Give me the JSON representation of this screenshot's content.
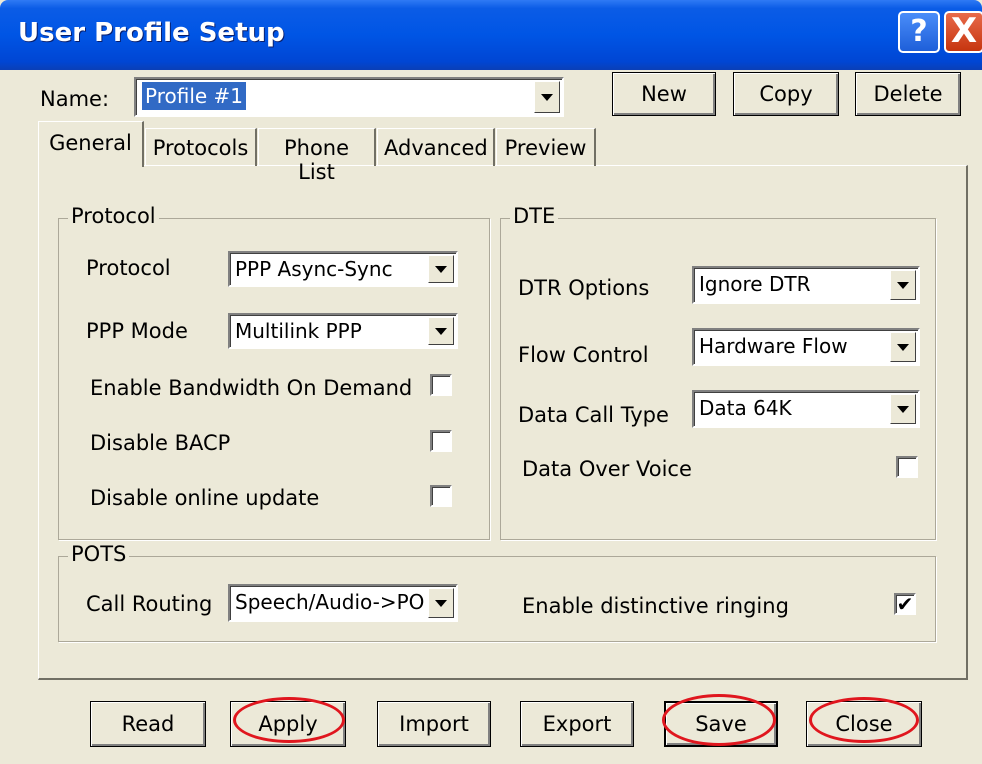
{
  "window": {
    "title": "User Profile Setup",
    "help_icon": "?",
    "close_icon": "X"
  },
  "name_row": {
    "label": "Name:",
    "value": "Profile #1",
    "new": "New",
    "copy": "Copy",
    "delete": "Delete"
  },
  "tabs": [
    "General",
    "Protocols",
    "Phone List",
    "Advanced",
    "Preview"
  ],
  "protocol_group": {
    "title": "Protocol",
    "protocol_label": "Protocol",
    "protocol_value": "PPP Async-Sync",
    "ppp_mode_label": "PPP Mode",
    "ppp_mode_value": "Multilink PPP",
    "bandwidth_label": "Enable Bandwidth On Demand",
    "bandwidth_checked": false,
    "bacp_label": "Disable BACP",
    "bacp_checked": false,
    "online_update_label": "Disable online update",
    "online_update_checked": false
  },
  "dte_group": {
    "title": "DTE",
    "dtr_label": "DTR Options",
    "dtr_value": "Ignore DTR",
    "flow_label": "Flow Control",
    "flow_value": "Hardware Flow",
    "call_type_label": "Data Call Type",
    "call_type_value": "Data 64K",
    "dov_label": "Data Over Voice",
    "dov_checked": false
  },
  "pots_group": {
    "title": "POTS",
    "routing_label": "Call Routing",
    "routing_value": "Speech/Audio->PO",
    "ringing_label": "Enable distinctive ringing",
    "ringing_checked": true,
    "check_mark": "✔"
  },
  "bottom_buttons": {
    "read": "Read",
    "apply": "Apply",
    "import": "Import",
    "export": "Export",
    "save": "Save",
    "close": "Close"
  },
  "colors": {
    "titlebar": "#0055e5",
    "face": "#ece9d8",
    "highlight_oval": "#e0161e",
    "selection": "#316ac5"
  }
}
